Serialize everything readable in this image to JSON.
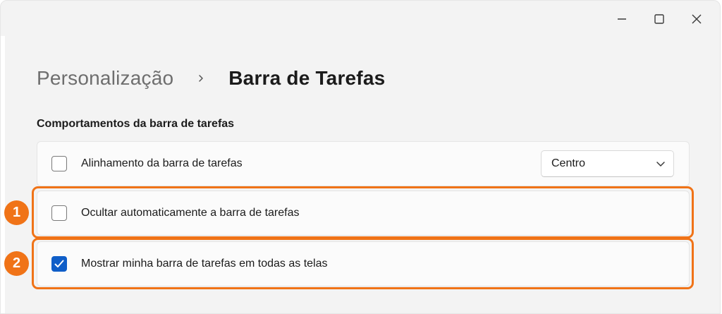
{
  "window": {
    "controls": {
      "minimize_icon": "minimize-icon",
      "maximize_icon": "maximize-icon",
      "close_icon": "close-icon"
    }
  },
  "breadcrumb": {
    "parent": "Personalização",
    "separator_icon": "chevron-right-icon",
    "current": "Barra de Tarefas"
  },
  "section": {
    "title": "Comportamentos da barra de tarefas",
    "rows": [
      {
        "label": "Alinhamento da barra de tarefas",
        "checked": false,
        "dropdown": {
          "value": "Centro",
          "icon": "chevron-down-icon"
        }
      },
      {
        "label": "Ocultar automaticamente a barra de tarefas",
        "checked": false
      },
      {
        "label": "Mostrar minha barra de tarefas em todas as telas",
        "checked": true
      }
    ]
  },
  "annotations": {
    "badges": [
      "1",
      "2"
    ],
    "color": "#f07317"
  },
  "colors": {
    "accent": "#0f5ec8",
    "highlight": "#f07317",
    "background": "#f3f3f3",
    "card": "#fbfbfb"
  }
}
